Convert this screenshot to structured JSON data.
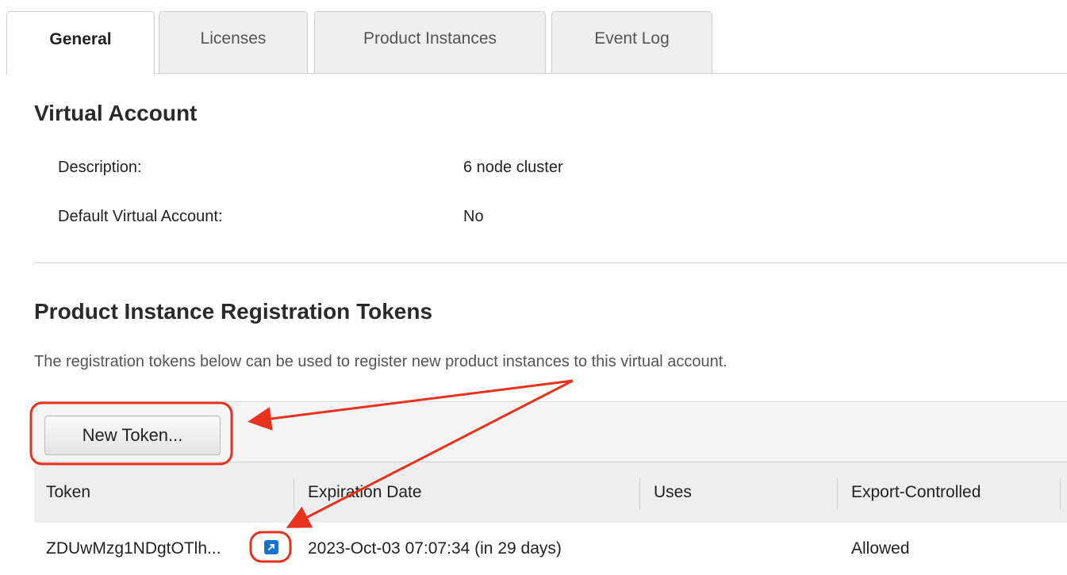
{
  "tabs": [
    {
      "label": "General",
      "active": true
    },
    {
      "label": "Licenses",
      "active": false
    },
    {
      "label": "Product Instances",
      "active": false
    },
    {
      "label": "Event Log",
      "active": false
    }
  ],
  "virtual_account": {
    "title": "Virtual Account",
    "description_label": "Description:",
    "description_value": "6 node cluster",
    "default_label": "Default Virtual Account:",
    "default_value": "No"
  },
  "tokens": {
    "title": "Product Instance Registration Tokens",
    "description": "The registration tokens below can be used to register new product instances to this virtual account.",
    "new_token_label": "New Token...",
    "columns": [
      "Token",
      "Expiration Date",
      "Uses",
      "Export-Controlled"
    ],
    "rows": [
      {
        "token": "ZDUwMzg1NDgtOTlh...",
        "expiration": "2023-Oct-03 07:07:34 (in 29 days)",
        "uses": "",
        "export_controlled": "Allowed"
      }
    ]
  },
  "icons": {
    "copy": "copy-link-icon"
  },
  "colors": {
    "annotation": "#e8321e",
    "icon_blue": "#1b73c7"
  }
}
